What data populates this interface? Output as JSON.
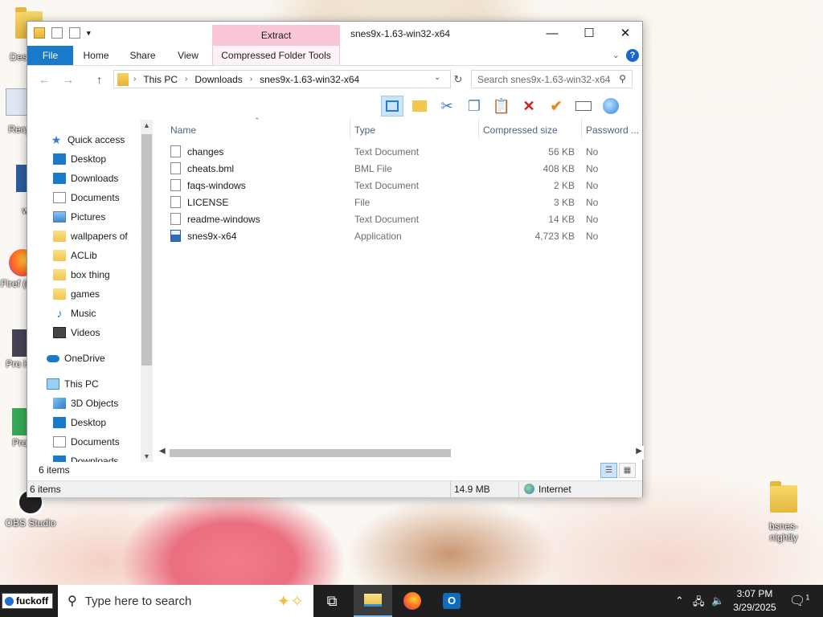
{
  "desktop": {
    "icons": [
      {
        "label": "Des Goo",
        "name": "desktop-icon-google"
      },
      {
        "label": "Recy",
        "name": "desktop-icon-recycle-bin"
      },
      {
        "label": "w",
        "name": "desktop-icon-w"
      },
      {
        "label": "Firef (no v",
        "name": "desktop-icon-firefox"
      },
      {
        "label": "Pro Ha",
        "name": "desktop-icon-project-ha"
      },
      {
        "label": "Proj",
        "name": "desktop-icon-project"
      },
      {
        "label": "OBS Studio",
        "name": "desktop-icon-obs-studio"
      },
      {
        "label": "bsnes-nightly",
        "name": "desktop-icon-bsnes-nightly"
      }
    ]
  },
  "window": {
    "title": "snes9x-1.63-win32-x64",
    "context_tab_group": "Extract",
    "tabs": [
      "File",
      "Home",
      "Share",
      "View",
      "Compressed Folder Tools"
    ],
    "address": {
      "crumbs": [
        "This PC",
        "Downloads",
        "snes9x-1.63-win32-x64"
      ]
    },
    "search_placeholder": "Search snes9x-1.63-win32-x64",
    "nav": {
      "quick_access": "Quick access",
      "items": [
        {
          "label": "Desktop",
          "pinned": true,
          "icon": "desktop-icon"
        },
        {
          "label": "Downloads",
          "pinned": true,
          "icon": "downloads-icon"
        },
        {
          "label": "Documents",
          "pinned": true,
          "icon": "documents-icon"
        },
        {
          "label": "Pictures",
          "pinned": true,
          "icon": "pictures-icon"
        },
        {
          "label": "wallpapers of",
          "pinned": true,
          "icon": "folder-icon"
        },
        {
          "label": "ACLib",
          "pinned": true,
          "icon": "folder-icon"
        },
        {
          "label": "box thing",
          "pinned": false,
          "icon": "folder-icon"
        },
        {
          "label": "games",
          "pinned": false,
          "icon": "folder-icon"
        },
        {
          "label": "Music",
          "pinned": false,
          "icon": "music-icon"
        },
        {
          "label": "Videos",
          "pinned": false,
          "icon": "videos-icon"
        }
      ],
      "onedrive": "OneDrive",
      "this_pc": "This PC",
      "pc_items": [
        {
          "label": "3D Objects",
          "icon": "3d-objects-icon"
        },
        {
          "label": "Desktop",
          "icon": "desktop-icon"
        },
        {
          "label": "Documents",
          "icon": "documents-icon"
        },
        {
          "label": "Downloads",
          "icon": "downloads-icon"
        }
      ]
    },
    "columns": [
      "Name",
      "Type",
      "Compressed size",
      "Password ..."
    ],
    "files": [
      {
        "name": "changes",
        "type": "Text Document",
        "size": "56 KB",
        "password": "No",
        "icon": "text-file"
      },
      {
        "name": "cheats.bml",
        "type": "BML File",
        "size": "408 KB",
        "password": "No",
        "icon": "text-file"
      },
      {
        "name": "faqs-windows",
        "type": "Text Document",
        "size": "2 KB",
        "password": "No",
        "icon": "text-file"
      },
      {
        "name": "LICENSE",
        "type": "File",
        "size": "3 KB",
        "password": "No",
        "icon": "text-file"
      },
      {
        "name": "readme-windows",
        "type": "Text Document",
        "size": "14 KB",
        "password": "No",
        "icon": "text-file"
      },
      {
        "name": "snes9x-x64",
        "type": "Application",
        "size": "4,723 KB",
        "password": "No",
        "icon": "application-file"
      }
    ],
    "item_count": "6 items",
    "status": {
      "items": "6 items",
      "size": "14.9 MB",
      "zone": "Internet"
    }
  },
  "taskbar": {
    "start_label": "fuckoff",
    "search_placeholder": "Type here to search",
    "time": "3:07 PM",
    "date": "3/29/2025",
    "notification_count": "1"
  }
}
